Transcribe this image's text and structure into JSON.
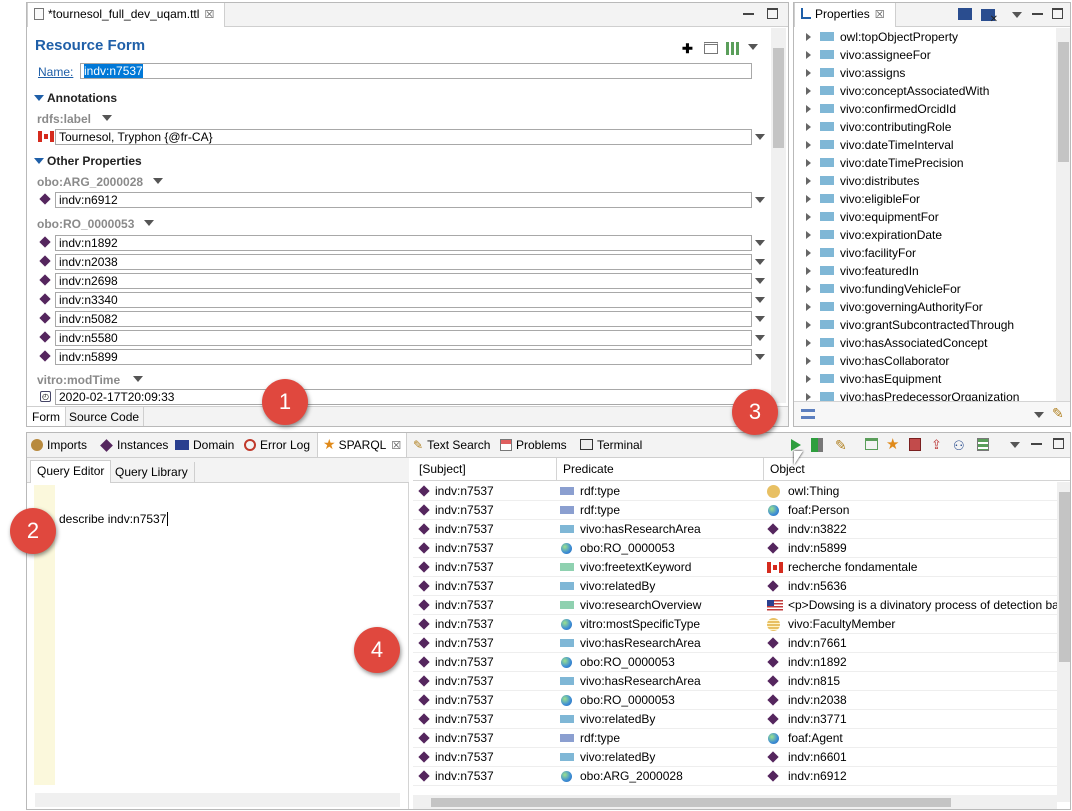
{
  "editor": {
    "tab_title": "*tournesol_full_dev_uqam.ttl",
    "heading": "Resource Form",
    "name_label": "Name:",
    "name_value": "indv:n7537",
    "annotations_label": "Annotations",
    "rdfs_label": "rdfs:label",
    "label_value": "Tournesol, Tryphon  {@fr-CA}",
    "other_label": "Other Properties",
    "arg_label": "obo:ARG_2000028",
    "arg_value": "indv:n6912",
    "ro_label": "obo:RO_0000053",
    "ro_values": [
      "indv:n1892",
      "indv:n2038",
      "indv:n2698",
      "indv:n3340",
      "indv:n5082",
      "indv:n5580",
      "indv:n5899"
    ],
    "modtime_label": "vitro:modTime",
    "modtime_value": "2020-02-17T20:09:33",
    "tab_form": "Form",
    "tab_source": "Source Code"
  },
  "properties": {
    "tab_title": "Properties",
    "items": [
      "owl:topObjectProperty",
      "vivo:assigneeFor",
      "vivo:assigns",
      "vivo:conceptAssociatedWith",
      "vivo:confirmedOrcidId",
      "vivo:contributingRole",
      "vivo:dateTimeInterval",
      "vivo:dateTimePrecision",
      "vivo:distributes",
      "vivo:eligibleFor",
      "vivo:equipmentFor",
      "vivo:expirationDate",
      "vivo:facilityFor",
      "vivo:featuredIn",
      "vivo:fundingVehicleFor",
      "vivo:governingAuthorityFor",
      "vivo:grantSubcontractedThrough",
      "vivo:hasAssociatedConcept",
      "vivo:hasCollaborator",
      "vivo:hasEquipment",
      "vivo:hasPredecessorOrganization"
    ]
  },
  "bottom_tabs": {
    "imports": "Imports",
    "instances": "Instances",
    "domain": "Domain",
    "error_log": "Error Log",
    "sparql": "SPARQL",
    "text_search": "Text Search",
    "problems": "Problems",
    "terminal": "Terminal"
  },
  "query": {
    "tab_editor": "Query Editor",
    "tab_library": "Query Library",
    "text": "describe indv:n7537"
  },
  "results": {
    "col_subject": "[Subject]",
    "col_predicate": "Predicate",
    "col_object": "Object",
    "rows": [
      {
        "s": "indv:n7537",
        "p": "rdf:type",
        "o": "owl:Thing",
        "pi": "bar-blue",
        "oi": "circle"
      },
      {
        "s": "indv:n7537",
        "p": "rdf:type",
        "o": "foaf:Person",
        "pi": "bar-blue",
        "oi": "globe"
      },
      {
        "s": "indv:n7537",
        "p": "vivo:hasResearchArea",
        "o": "indv:n3822",
        "pi": "bar-cyan",
        "oi": "diamond"
      },
      {
        "s": "indv:n7537",
        "p": "obo:RO_0000053",
        "o": "indv:n5899",
        "pi": "globe",
        "oi": "diamond"
      },
      {
        "s": "indv:n7537",
        "p": "vivo:freetextKeyword",
        "o": "recherche fondamentale",
        "pi": "bar-green",
        "oi": "flag-ca"
      },
      {
        "s": "indv:n7537",
        "p": "vivo:relatedBy",
        "o": "indv:n5636",
        "pi": "bar-cyan",
        "oi": "diamond"
      },
      {
        "s": "indv:n7537",
        "p": "vivo:researchOverview",
        "o": "<p>Dowsing is a divinatory process of detection ba",
        "pi": "bar-green",
        "oi": "flag-us"
      },
      {
        "s": "indv:n7537",
        "p": "vitro:mostSpecificType",
        "o": "vivo:FacultyMember",
        "pi": "globe",
        "oi": "circle-lines"
      },
      {
        "s": "indv:n7537",
        "p": "vivo:hasResearchArea",
        "o": "indv:n7661",
        "pi": "bar-cyan",
        "oi": "diamond"
      },
      {
        "s": "indv:n7537",
        "p": "obo:RO_0000053",
        "o": "indv:n1892",
        "pi": "globe",
        "oi": "diamond"
      },
      {
        "s": "indv:n7537",
        "p": "vivo:hasResearchArea",
        "o": "indv:n815",
        "pi": "bar-cyan",
        "oi": "diamond"
      },
      {
        "s": "indv:n7537",
        "p": "obo:RO_0000053",
        "o": "indv:n2038",
        "pi": "globe",
        "oi": "diamond"
      },
      {
        "s": "indv:n7537",
        "p": "vivo:relatedBy",
        "o": "indv:n3771",
        "pi": "bar-cyan",
        "oi": "diamond"
      },
      {
        "s": "indv:n7537",
        "p": "rdf:type",
        "o": "foaf:Agent",
        "pi": "bar-blue",
        "oi": "globe"
      },
      {
        "s": "indv:n7537",
        "p": "vivo:relatedBy",
        "o": "indv:n6601",
        "pi": "bar-cyan",
        "oi": "diamond"
      },
      {
        "s": "indv:n7537",
        "p": "obo:ARG_2000028",
        "o": "indv:n6912",
        "pi": "globe",
        "oi": "diamond"
      }
    ]
  },
  "callouts": [
    "1",
    "2",
    "3",
    "4"
  ],
  "colors": {
    "heading": "#1f5fa8",
    "selection": "#0078d7",
    "diamond": "#55265e",
    "callout": "#e0483e",
    "bar_blue": "#8b9fd0",
    "bar_cyan": "#7fb7d6",
    "bar_green": "#8fd1b0"
  }
}
